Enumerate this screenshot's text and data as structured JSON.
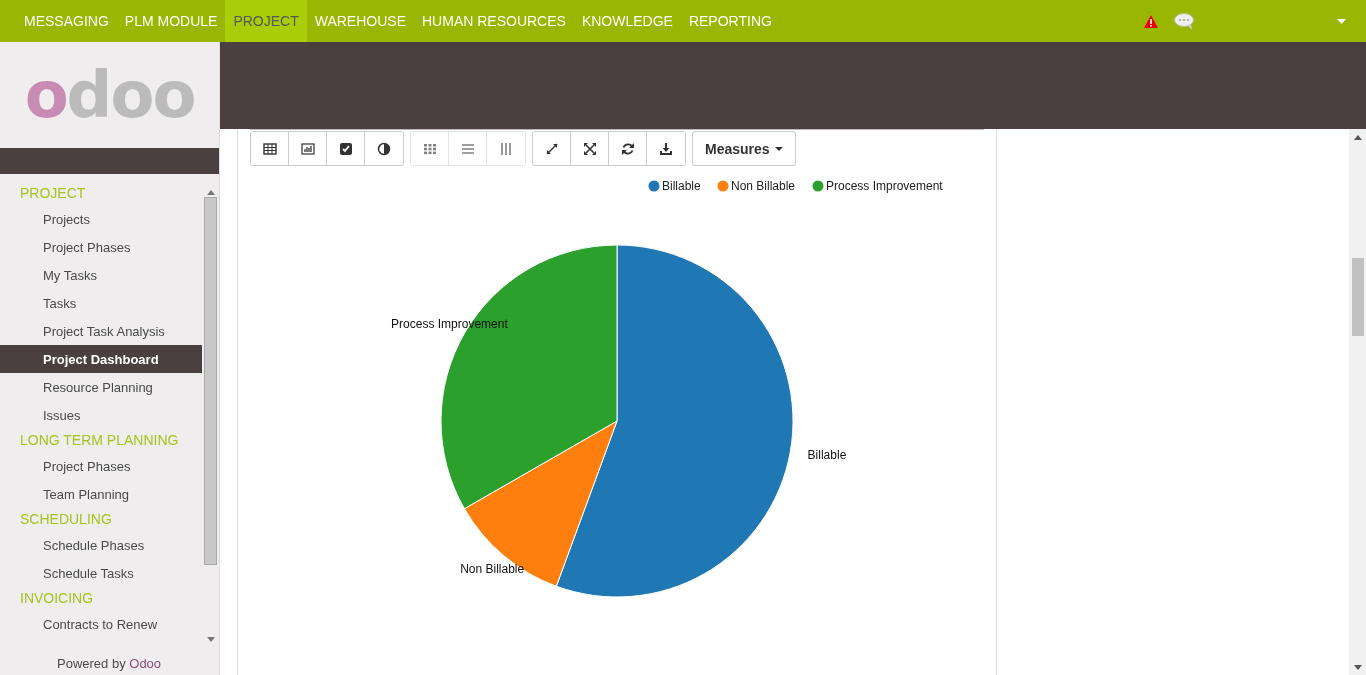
{
  "top_menu": [
    {
      "label": "MESSAGING",
      "selected": false
    },
    {
      "label": "PLM MODULE",
      "selected": false
    },
    {
      "label": "PROJECT",
      "selected": true
    },
    {
      "label": "WAREHOUSE",
      "selected": false
    },
    {
      "label": "HUMAN RESOURCES",
      "selected": false
    },
    {
      "label": "KNOWLEDGE",
      "selected": false
    },
    {
      "label": "REPORTING",
      "selected": false
    }
  ],
  "sidebar": {
    "logo": "odoo",
    "sections": [
      {
        "title": "PROJECT",
        "items": [
          {
            "label": "Projects",
            "selected": false
          },
          {
            "label": "Project Phases",
            "selected": false
          },
          {
            "label": "My Tasks",
            "selected": false
          },
          {
            "label": "Tasks",
            "selected": false
          },
          {
            "label": "Project Task Analysis",
            "selected": false
          },
          {
            "label": "Project Dashboard",
            "selected": true
          },
          {
            "label": "Resource Planning",
            "selected": false
          },
          {
            "label": "Issues",
            "selected": false
          }
        ]
      },
      {
        "title": "LONG TERM PLANNING",
        "items": [
          {
            "label": "Project Phases",
            "selected": false
          },
          {
            "label": "Team Planning",
            "selected": false
          }
        ]
      },
      {
        "title": "SCHEDULING",
        "items": [
          {
            "label": "Schedule Phases",
            "selected": false
          },
          {
            "label": "Schedule Tasks",
            "selected": false
          }
        ]
      },
      {
        "title": "INVOICING",
        "items": [
          {
            "label": "Contracts to Renew",
            "selected": false
          }
        ]
      }
    ],
    "powered_by": "Powered by",
    "powered_brand": "Odoo"
  },
  "toolbar": {
    "groups": [
      {
        "disabled": false
      },
      {
        "disabled": true
      },
      {
        "disabled": false
      }
    ],
    "measures": "Measures"
  },
  "legend": [
    {
      "label": "Billable",
      "color": "#1f77b4"
    },
    {
      "label": "Non Billable",
      "color": "#ff7f0e"
    },
    {
      "label": "Process Improvement",
      "color": "#2ca02c"
    }
  ],
  "chart_data": {
    "type": "pie",
    "categories": [
      "Billable",
      "Non Billable",
      "Process Improvement"
    ],
    "values": [
      55.6,
      11.1,
      33.3
    ]
  }
}
